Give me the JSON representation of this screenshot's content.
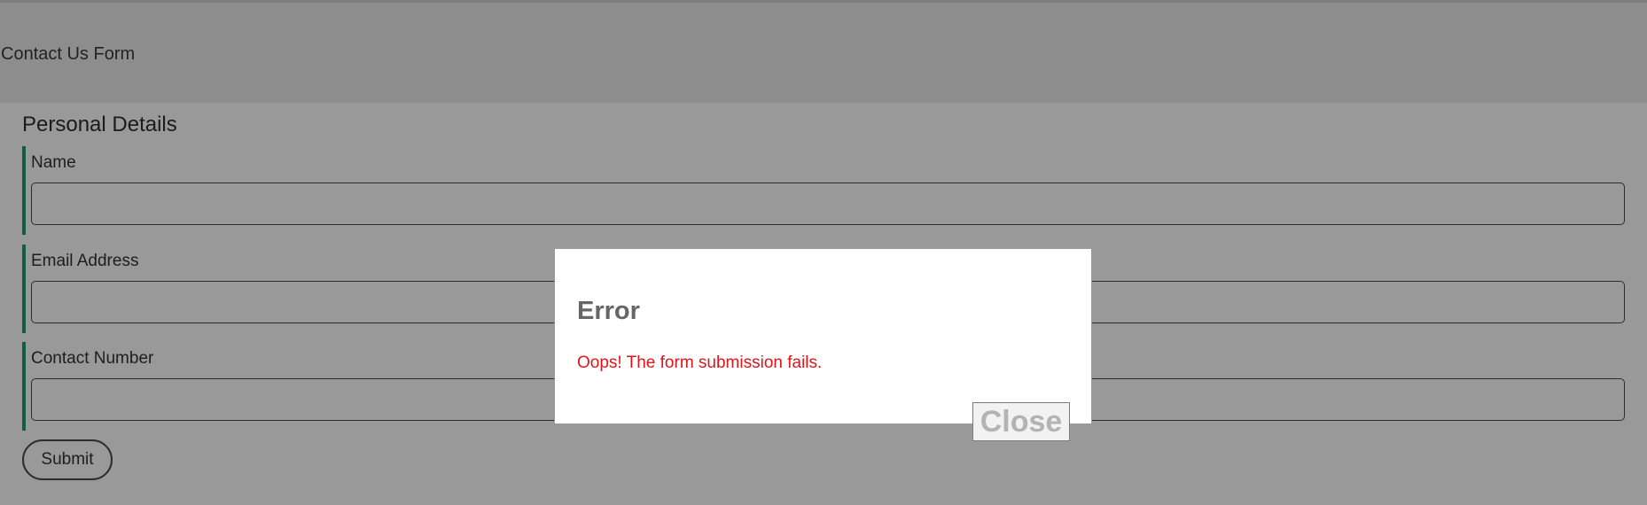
{
  "header": {
    "title": "Contact Us Form"
  },
  "form": {
    "section_title": "Personal Details",
    "fields": [
      {
        "label": "Name",
        "value": ""
      },
      {
        "label": "Email Address",
        "value": ""
      },
      {
        "label": "Contact Number",
        "value": ""
      }
    ],
    "submit_label": "Submit"
  },
  "modal": {
    "title": "Error",
    "message": "Oops! The form submission fails.",
    "close_label": "Close"
  },
  "colors": {
    "accent_border": "#1f9d6b",
    "error_text": "#e0141b",
    "overlay": "rgba(0,0,0,0.4)"
  }
}
